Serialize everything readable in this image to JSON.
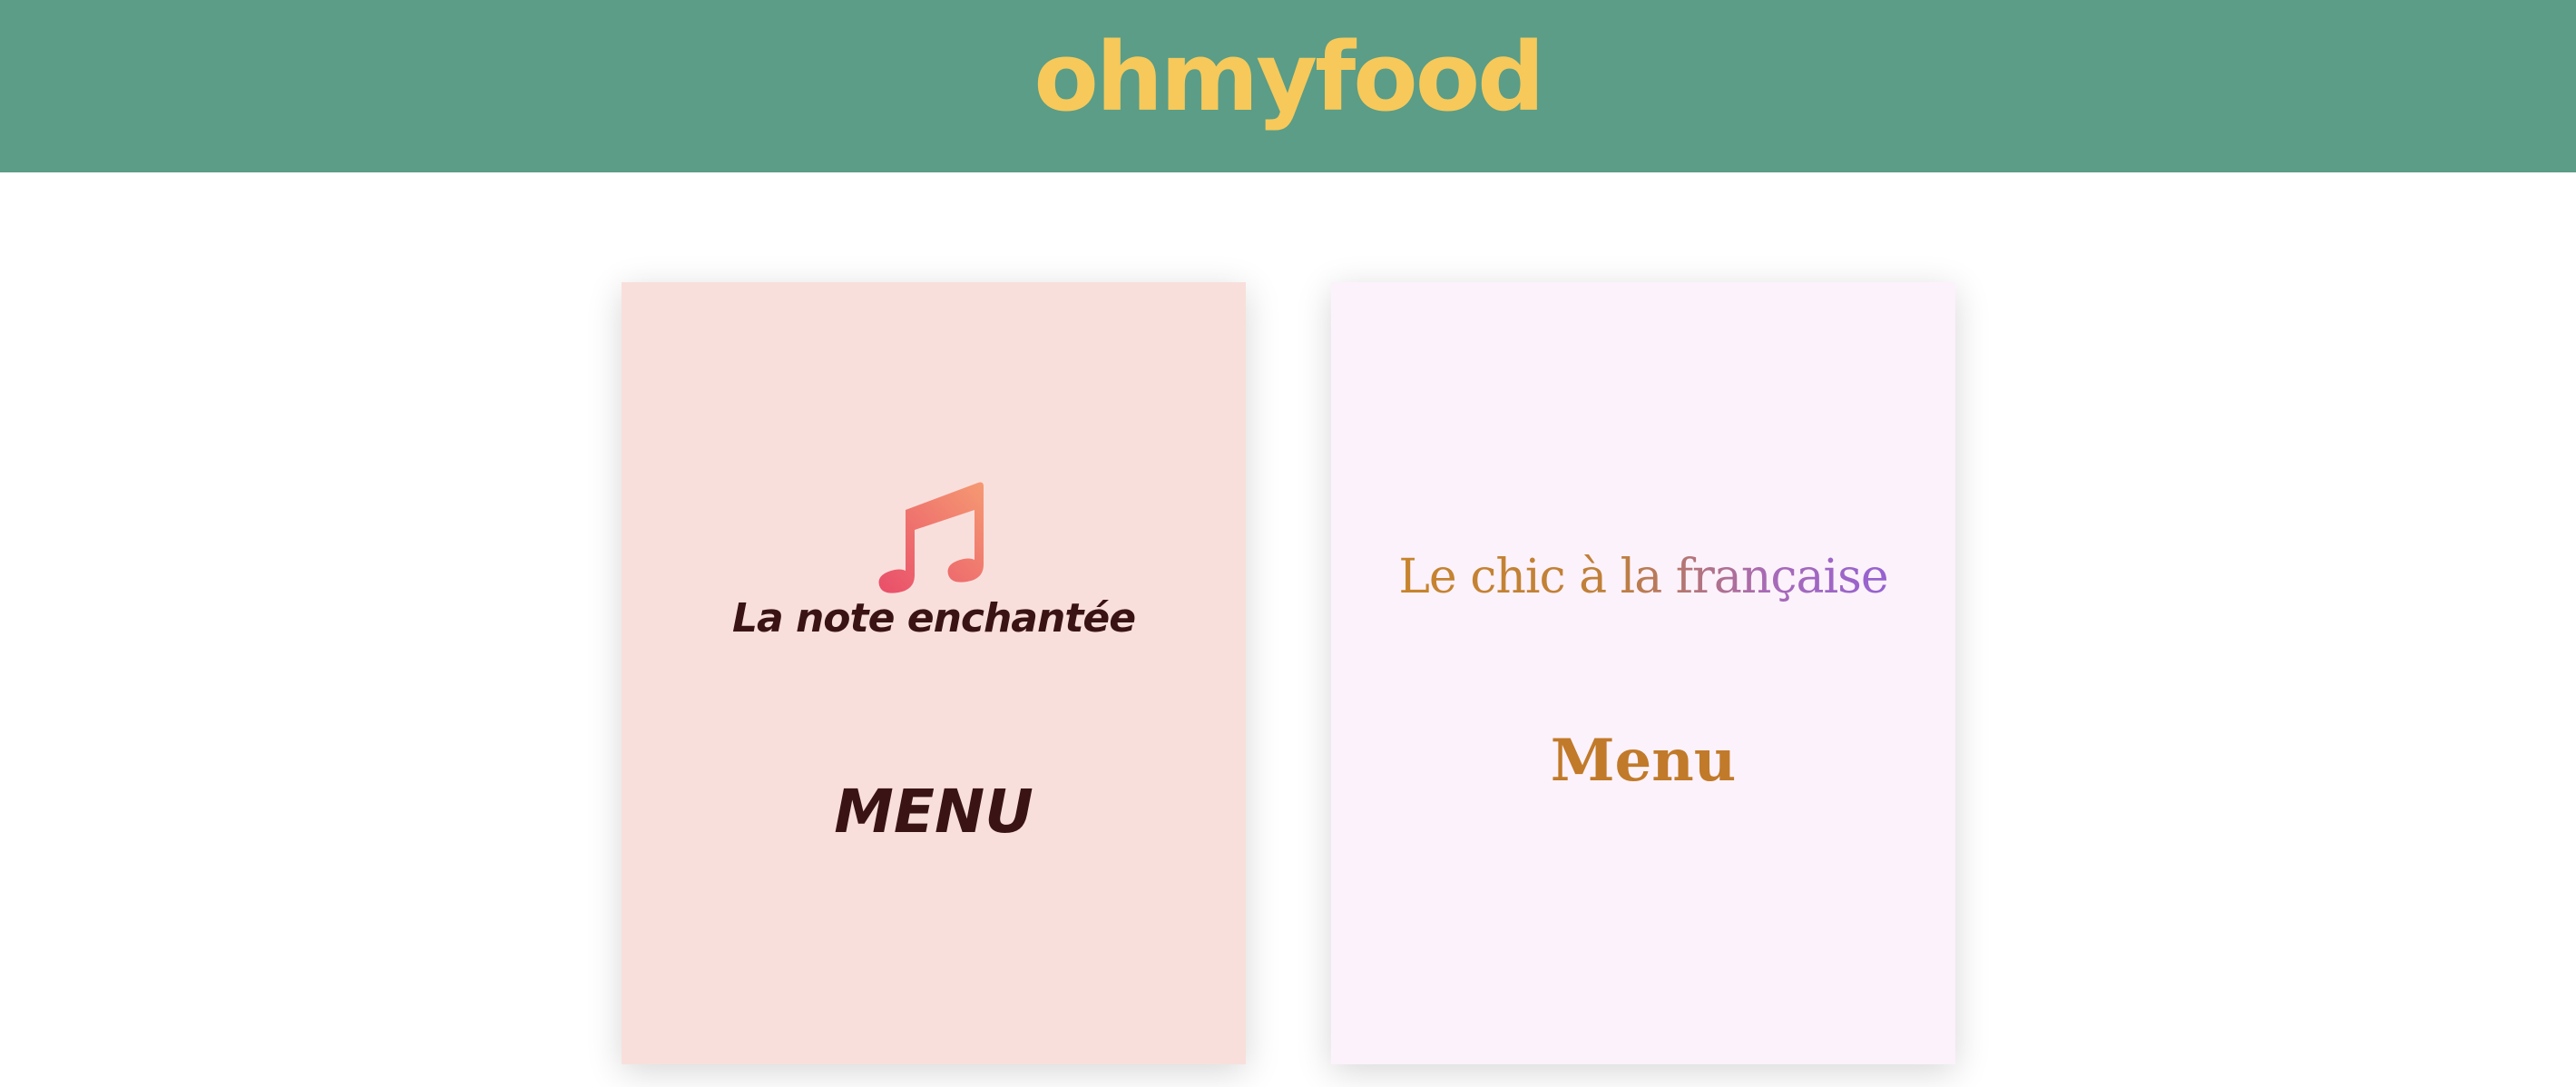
{
  "header": {
    "logo_text": "ohmyfood",
    "background_color": "#5b9d87",
    "logo_color": "#f6c95a"
  },
  "cards": [
    {
      "icon": "music-note-icon",
      "title": "La note enchantée",
      "menu_label": "MENU",
      "background_color": "#f9dfdc",
      "text_color": "#3a1414",
      "icon_gradient": [
        "#e94e6a",
        "#f59a72"
      ]
    },
    {
      "title": "Le chic à la française",
      "menu_label": "Menu",
      "background_color": "#fcf2fb",
      "title_gradient": [
        "#c9852a",
        "#8a5ee0"
      ],
      "menu_color": "#c17a2a"
    }
  ]
}
